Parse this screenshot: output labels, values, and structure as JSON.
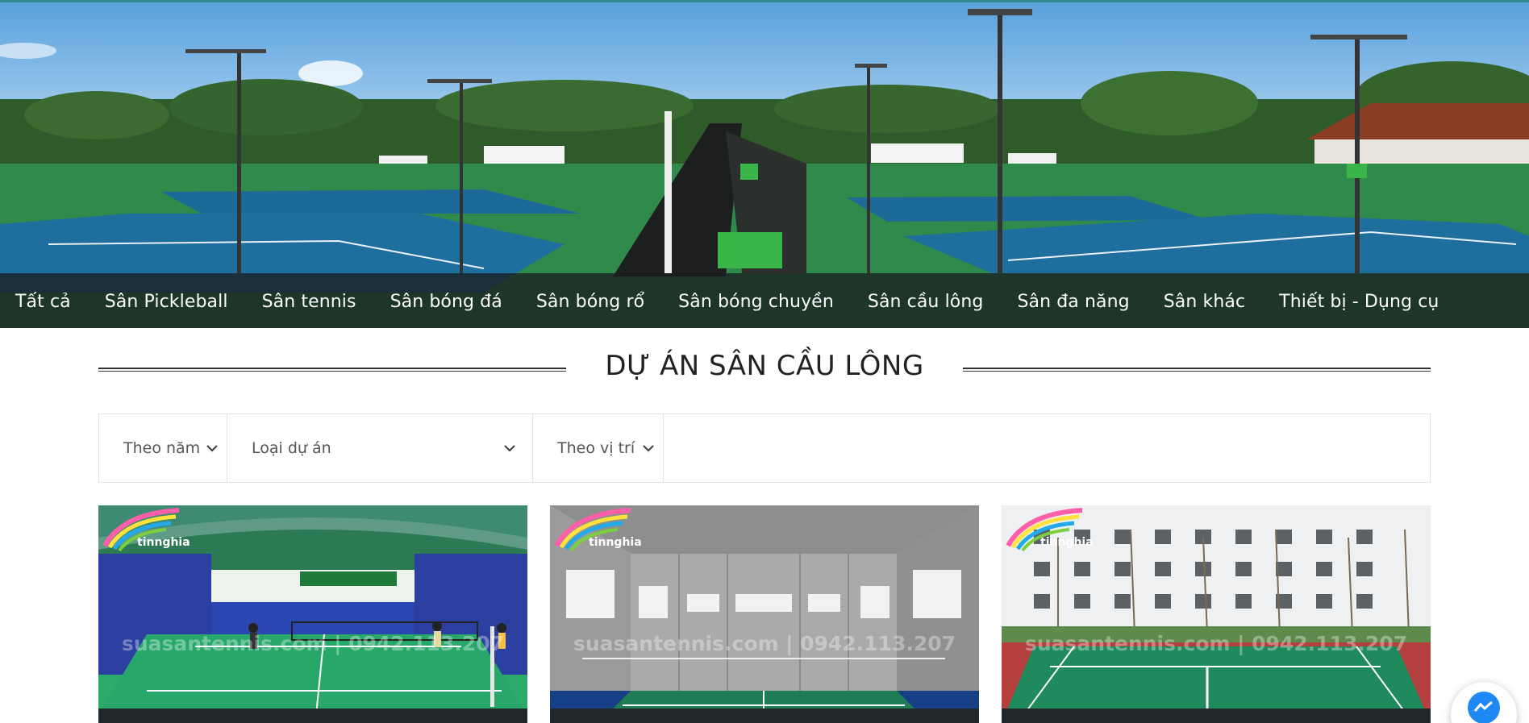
{
  "nav": {
    "items": [
      {
        "label": "Tất cả"
      },
      {
        "label": "Sân Pickleball"
      },
      {
        "label": "Sân tennis"
      },
      {
        "label": "Sân bóng đá"
      },
      {
        "label": "Sân bóng rổ"
      },
      {
        "label": "Sân bóng chuyền"
      },
      {
        "label": "Sân cầu lông"
      },
      {
        "label": "Sân đa năng"
      },
      {
        "label": "Sân khác"
      },
      {
        "label": "Thiết bị - Dụng cụ"
      }
    ]
  },
  "section": {
    "title": "DỰ ÁN SÂN CẦU LÔNG"
  },
  "filters": {
    "year": "Theo năm",
    "project_type": "Loại dự án",
    "location": "Theo vị trí"
  },
  "cards": [
    {
      "logo": "tinnghia",
      "watermark": "suasantennis.com  |  0942.113.207"
    },
    {
      "logo": "tinnghia",
      "watermark": "suasantennis.com  |  0942.113.207"
    },
    {
      "logo": "tinnghia",
      "watermark": "suasantennis.com  |  0942.113.207"
    }
  ],
  "colors": {
    "nav_bg": "#191e20",
    "court_blue": "#1f6fa0",
    "court_green": "#2e8a4e",
    "messenger": "#1e88f5"
  },
  "icons": {
    "dropdown": "chevron-down-icon",
    "chat": "messenger-icon"
  }
}
